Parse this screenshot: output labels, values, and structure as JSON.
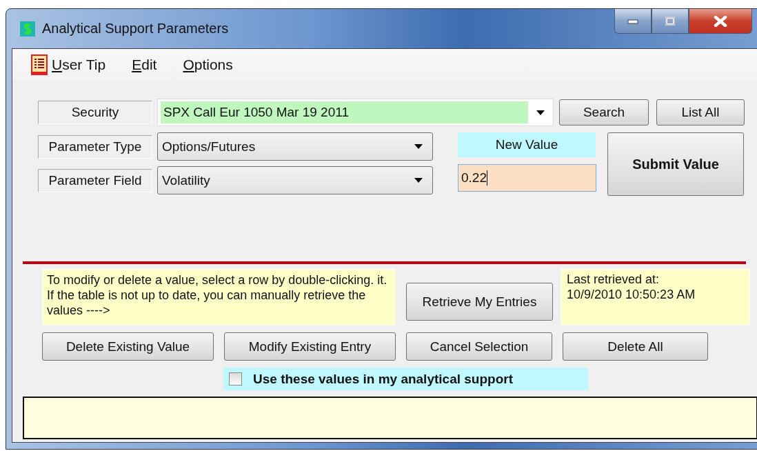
{
  "window": {
    "title": "Analytical Support Parameters"
  },
  "menu": [
    {
      "label": "User Tip",
      "kind": "icon"
    },
    {
      "label": "Edit",
      "kind": "plain"
    },
    {
      "label": "Options",
      "kind": "plain"
    }
  ],
  "security": {
    "label": "Security",
    "value": "SPX Call Eur 1050 Mar 19 2011"
  },
  "search_button": "Search",
  "list_all_button": "List All",
  "parameter_type": {
    "label": "Parameter Type",
    "value": "Options/Futures"
  },
  "parameter_field": {
    "label": "Parameter Field",
    "value": "Volatility"
  },
  "new_value": {
    "label": "New Value",
    "value": "0.22"
  },
  "submit_button": "Submit Value",
  "note": "To modify or delete a value, select a row by double-clicking. it.  If the table is not up to date, you can manually retrieve the values ---->",
  "retrieve_button": "Retrieve My Entries",
  "last_retrieved": [
    "Last retrieved at:",
    "10/9/2010 10:50:23 AM"
  ],
  "actions": [
    "Delete Existing Value",
    "Modify Existing Entry",
    "Cancel Selection",
    "Delete All"
  ],
  "use_values": {
    "label": "Use these values in my analytical support",
    "checked": false
  }
}
